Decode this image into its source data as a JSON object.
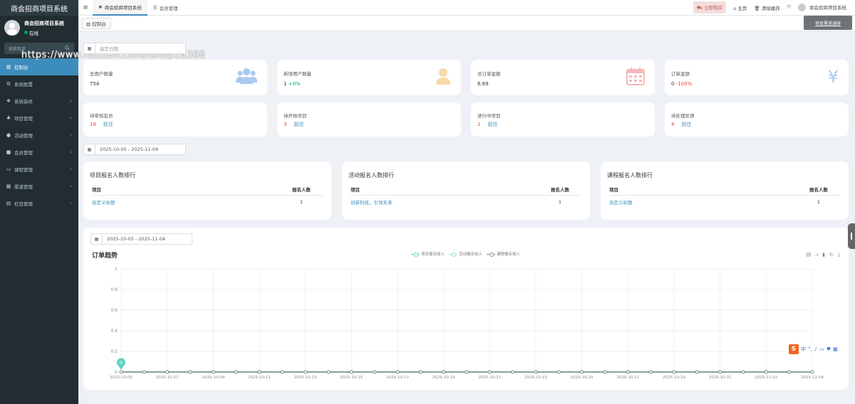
{
  "sidebar": {
    "title": "商会招商项目系统",
    "user_name": "商会招商项目系统",
    "user_status": "在线",
    "search_placeholder": "搜索菜单",
    "items": [
      {
        "label": "控制台",
        "icon": "dashboard-icon"
      },
      {
        "label": "系统配置",
        "icon": "gears-icon"
      },
      {
        "label": "系统装修",
        "icon": "cubes-icon"
      },
      {
        "label": "项目管理",
        "icon": "sitemap-icon"
      },
      {
        "label": "活动管理",
        "icon": "info-circle-icon"
      },
      {
        "label": "会员管理",
        "icon": "lock-icon"
      },
      {
        "label": "课程管理",
        "icon": "id-card-icon"
      },
      {
        "label": "渠道管理",
        "icon": "grid-icon"
      },
      {
        "label": "栏目管理",
        "icon": "columns-icon"
      }
    ]
  },
  "header": {
    "tabs": [
      {
        "label": "商会招商项目系统",
        "icon": "cubes-icon"
      },
      {
        "label": "会员管理",
        "icon": "list-icon"
      }
    ],
    "buy_label": "立即购买",
    "home_label": "主页",
    "clear_cache_label": "清除缓存",
    "user_label": "商会招商项目系统"
  },
  "subbar": {
    "tab_label": "控制台"
  },
  "toast": {
    "text": "项目需求调研"
  },
  "watermark": "https://www.huzhan.com/ishop18368",
  "filters": {
    "date_placeholder": "指定日期",
    "range1": "2025-10-05 - 2025-11-04",
    "range2": "2025-10-05 - 2025-11-04"
  },
  "stats": [
    {
      "label": "总用户数量",
      "value": "754",
      "change": "",
      "icon": "users-icon",
      "color": "#a9c9f0"
    },
    {
      "label": "新增用户数量",
      "value": "1",
      "change": "+0%",
      "icon": "user-icon",
      "color": "#f8d9a8"
    },
    {
      "label": "总订单金额",
      "value": "6.69",
      "change": "",
      "icon": "calendar-icon",
      "color": "#f6b8b8"
    },
    {
      "label": "订单金额",
      "value": "0",
      "change": "-100%",
      "icon": "yen-icon",
      "color": "#a9c9f0"
    }
  ],
  "todos": [
    {
      "label": "待审核会员",
      "value": "18",
      "link": "前往"
    },
    {
      "label": "待开始项目",
      "value": "3",
      "link": "前往"
    },
    {
      "label": "进行中项目",
      "value": "1",
      "link": "前往"
    },
    {
      "label": "待处理反馈",
      "value": "4",
      "link": "前往"
    }
  ],
  "rankings": [
    {
      "title": "项目报名人数排行",
      "col1": "项目",
      "col2": "报名人数",
      "rows": [
        {
          "name": "自定义标题",
          "count": "1"
        }
      ]
    },
    {
      "title": "活动报名人数排行",
      "col1": "项目",
      "col2": "报名人数",
      "rows": [
        {
          "name": "创新科技，引领未来",
          "count": "1"
        }
      ]
    },
    {
      "title": "课程报名人数排行",
      "col1": "项目",
      "col2": "报名人数",
      "rows": [
        {
          "name": "自定义标题",
          "count": "1"
        }
      ]
    }
  ],
  "chart_data": {
    "type": "line",
    "title": "订单趋势",
    "xlabel": "",
    "ylabel": "",
    "ylim": [
      0,
      1
    ],
    "yticks": [
      "0",
      "0.2",
      "0.4",
      "0.6",
      "0.8",
      "1"
    ],
    "xticks": [
      "2025-10-05",
      "2025-10-07",
      "2025-10-09",
      "2025-10-11",
      "2025-10-13",
      "2025-10-15",
      "2025-10-17",
      "2025-10-19",
      "2025-10-21",
      "2025-10-23",
      "2025-10-25",
      "2025-10-27",
      "2025-10-29",
      "2025-10-31",
      "2025-11-02",
      "2025-11-04"
    ],
    "x": [
      "2025-10-05",
      "2025-10-06",
      "2025-10-07",
      "2025-10-08",
      "2025-10-09",
      "2025-10-10",
      "2025-10-11",
      "2025-10-12",
      "2025-10-13",
      "2025-10-14",
      "2025-10-15",
      "2025-10-16",
      "2025-10-17",
      "2025-10-18",
      "2025-10-19",
      "2025-10-20",
      "2025-10-21",
      "2025-10-22",
      "2025-10-23",
      "2025-10-24",
      "2025-10-25",
      "2025-10-26",
      "2025-10-27",
      "2025-10-28",
      "2025-10-29",
      "2025-10-30",
      "2025-10-31",
      "2025-11-01",
      "2025-11-02",
      "2025-11-03",
      "2025-11-04"
    ],
    "series": [
      {
        "name": "项目报名收入",
        "color": "#5fd3c3",
        "values": [
          0,
          0,
          0,
          0,
          0,
          0,
          0,
          0,
          0,
          0,
          0,
          0,
          0,
          0,
          0,
          0,
          0,
          0,
          0,
          0,
          0,
          0,
          0,
          0,
          0,
          0,
          0,
          0,
          0,
          0,
          0
        ]
      },
      {
        "name": "活动报名收入",
        "color": "#8be0d6",
        "values": [
          0,
          0,
          0,
          0,
          0,
          0,
          0,
          0,
          0,
          0,
          0,
          0,
          0,
          0,
          0,
          0,
          0,
          0,
          0,
          0,
          0,
          0,
          0,
          0,
          0,
          0,
          0,
          0,
          0,
          0,
          0
        ]
      },
      {
        "name": "课程报名收入",
        "color": "#888888",
        "values": [
          0,
          0,
          0,
          0,
          0,
          0,
          0,
          0,
          0,
          0,
          0,
          0,
          0,
          0,
          0,
          0,
          0,
          0,
          0,
          0,
          0,
          0,
          0,
          0,
          0,
          0,
          0,
          0,
          0,
          0,
          0
        ]
      }
    ],
    "marker_label": "0",
    "grid": true,
    "legend": "top-center"
  },
  "ime": {
    "label": "中"
  }
}
